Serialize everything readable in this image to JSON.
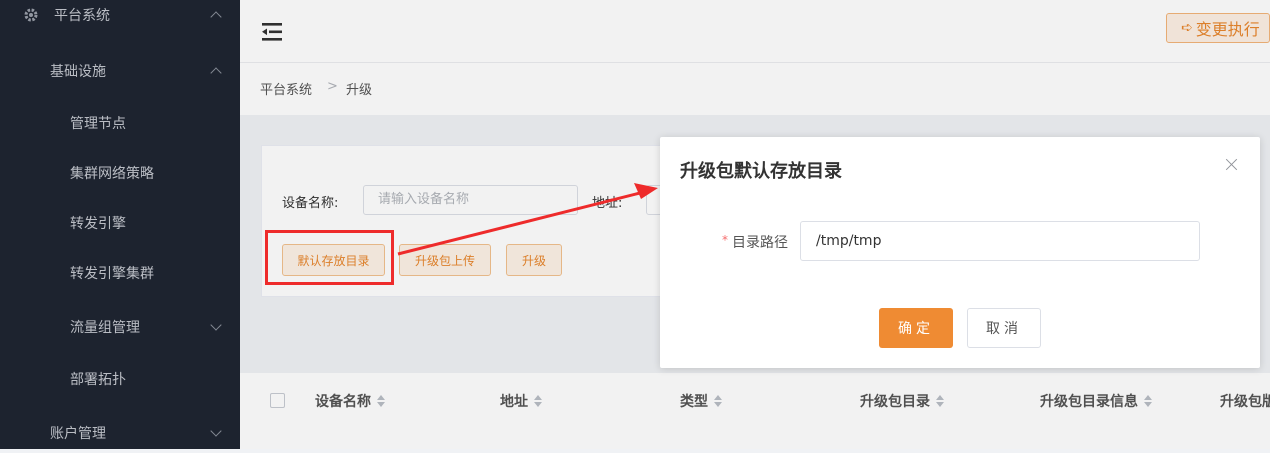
{
  "sidebar": {
    "platform": "平台系统",
    "infra": "基础设施",
    "items": [
      "管理节点",
      "集群网络策略",
      "转发引擎",
      "转发引擎集群",
      "流量组管理",
      "部署拓扑"
    ],
    "account": "账户管理"
  },
  "header": {
    "change_label": "变更执行"
  },
  "breadcrumb": {
    "root": "平台系统",
    "current": "升级"
  },
  "filters": {
    "device_label": "设备名称:",
    "device_placeholder": "请输入设备名称",
    "address_label": "地址:"
  },
  "actions": {
    "default_dir": "默认存放目录",
    "upload": "升级包上传",
    "upgrade": "升级"
  },
  "table": {
    "columns": [
      "设备名称",
      "地址",
      "类型",
      "升级包目录",
      "升级包目录信息",
      "升级包版本"
    ]
  },
  "dialog": {
    "title": "升级包默认存放目录",
    "required_mark": "*",
    "path_label": "目录路径",
    "path_value": "/tmp/tmp",
    "ok": "确定",
    "cancel": "取消"
  },
  "colors": {
    "sidebar_bg": "#1f2532",
    "accent": "#ef8b33",
    "annotation": "#ee2b2b"
  }
}
